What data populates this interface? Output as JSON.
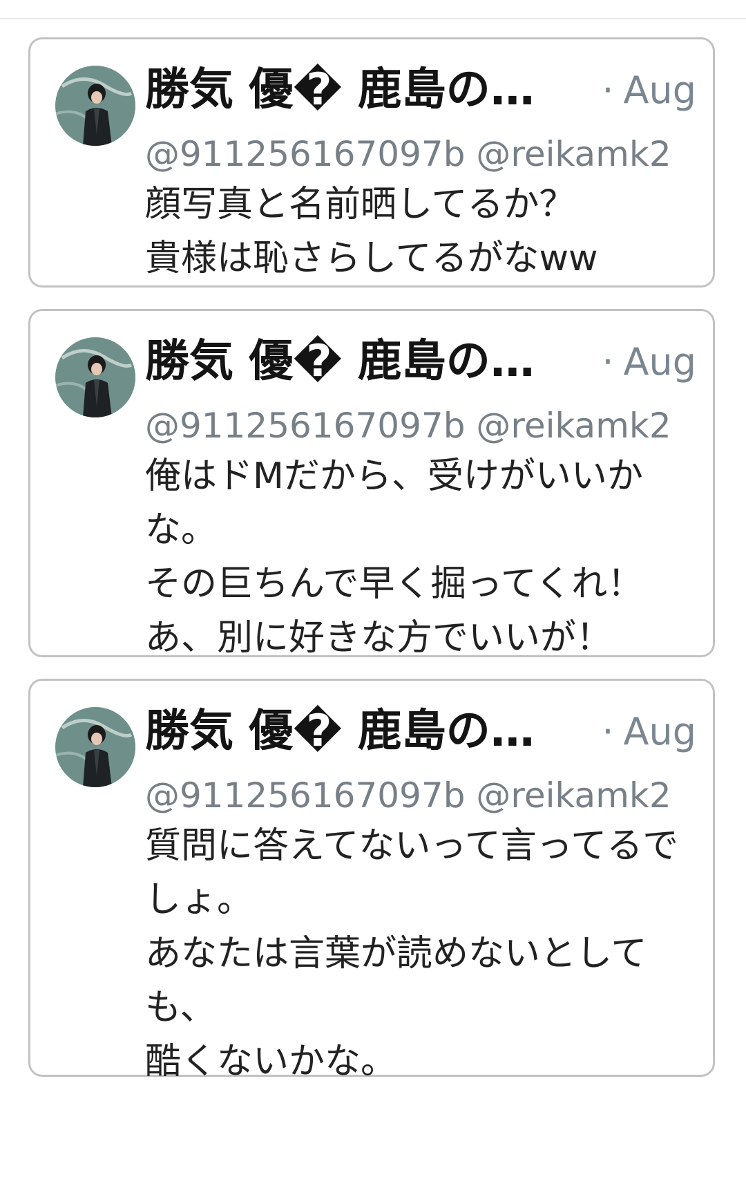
{
  "tweets": [
    {
      "name": "勝気 優� 鹿島の絵...",
      "date": "Aug",
      "handles": "@911256167097b @reikamk2",
      "text": "顔写真と名前晒してるか？\n貴様は恥さらしてるがなww"
    },
    {
      "name": "勝気 優� 鹿島の絵...",
      "date": "Aug",
      "handles": "@911256167097b @reikamk2",
      "text": "俺はドMだから、受けがいいかな。\nその巨ちんで早く掘ってくれ！\nあ、別に好きな方でいいが！"
    },
    {
      "name": "勝気 優� 鹿島の絵...",
      "date": "Aug",
      "handles": "@911256167097b @reikamk2",
      "text": "質問に答えてないって言ってるでしょ。\nあなたは言葉が読めないとしても、\n酷くないかな。"
    }
  ],
  "colors": {
    "card_border": "#c2c2c2",
    "meta_text": "#7a8691",
    "handle_text": "#777f87"
  },
  "icons": {
    "avatar": "avatar-image"
  }
}
